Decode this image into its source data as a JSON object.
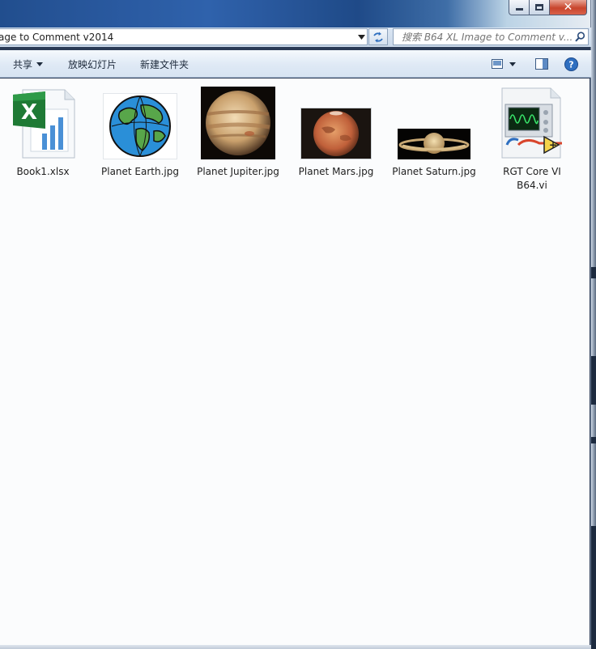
{
  "address": {
    "path": "age to Comment v2014"
  },
  "search": {
    "placeholder": "搜索 B64 XL Image to Comment v..."
  },
  "toolbar": {
    "share_label": "共享",
    "slideshow_label": "放映幻灯片",
    "new_folder_label": "新建文件夹"
  },
  "files": [
    {
      "name": "Book1.xlsx",
      "icon": "excel-file-icon"
    },
    {
      "name": "Planet Earth.jpg",
      "icon": "earth-thumbnail"
    },
    {
      "name": "Planet Jupiter.jpg",
      "icon": "jupiter-thumbnail"
    },
    {
      "name": "Planet Mars.jpg",
      "icon": "mars-thumbnail"
    },
    {
      "name": "Planet Saturn.jpg",
      "icon": "saturn-thumbnail"
    },
    {
      "name": "RGT Core VI B64.vi",
      "icon": "labview-vi-icon"
    }
  ],
  "colors": {
    "window_frame": "#cbd9ea",
    "content_bg": "#fbfcfd",
    "close_button": "#c8452c",
    "help_icon": "#2f6fc0"
  }
}
